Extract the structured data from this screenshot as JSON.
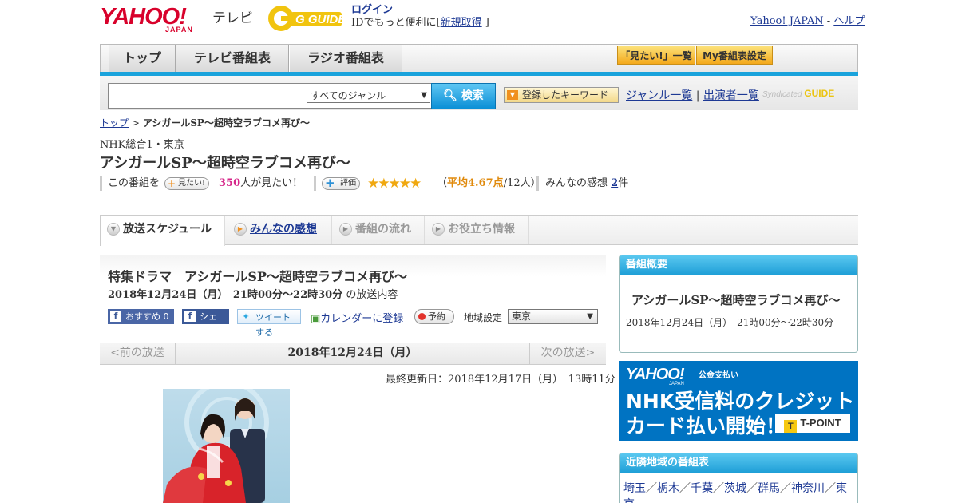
{
  "header": {
    "logo_text": "YAHOO!",
    "logo_sub": "JAPAN",
    "service": "テレビ",
    "gguide_logo": "G GUIDE",
    "login": "ログイン",
    "login_note_prefix": "IDでもっと便利に[",
    "signup": "新規取得",
    "login_note_suffix": "]",
    "yahoo_japan": "Yahoo! JAPAN",
    "sep": "-",
    "help": "ヘルプ"
  },
  "nav": {
    "tabs": [
      "トップ",
      "テレビ番組表",
      "ラジオ番組表"
    ],
    "mitai_list": "「見たい!」一覧",
    "my_schedule": "My番組表設定"
  },
  "search": {
    "genre_selected": "すべてのジャンル",
    "button": "検索",
    "keyword_btn": "登録したキーワード",
    "genre_list": "ジャンル一覧",
    "divider": "|",
    "performer_list": "出演者一覧",
    "syndicated": "Syndicated",
    "syndicated_logo": "GUIDE"
  },
  "breadcrumb": {
    "top": "トップ",
    "sep": ">",
    "current": "アシガールSP～超時空ラブコメ再び～"
  },
  "program": {
    "channel": "NHK総合1・東京",
    "title": "アシガールSP～超時空ラブコメ再び～",
    "this_program": "この番組を",
    "mitai_btn": "見たい!",
    "mitai_count": "350",
    "mitai_suffix": "人が見たい！",
    "rate_btn": "評価",
    "stars": "★★★★★",
    "rating_open": "（",
    "rating_avg": "平均4.67点",
    "rating_people": "/12人）",
    "impressions_label": "みんなの感想",
    "impressions_count": "2",
    "impressions_suffix": "件"
  },
  "detail_tabs": [
    "放送スケジュール",
    "みんなの感想",
    "番組の流れ",
    "お役立ち情報"
  ],
  "broadcast": {
    "heading": "特集ドラマ　アシガールSP～超時空ラブコメ再び～",
    "date_time": "2018年12月24日（月）　21時00分～22時30分",
    "date_suffix": "の放送内容",
    "fb_recommend": "おすすめ 0",
    "fb_share": "シェア",
    "tweet": "ツイートする",
    "calendar": "カレンダーに登録",
    "reserve": "予約",
    "region_label": "地域設定",
    "region_value": "東京",
    "prev": "<前の放送",
    "current_date": "2018年12月24日（月）",
    "next": "次の放送>",
    "updated": "最終更新日：2018年12月17日（月）　13時11分"
  },
  "overview": {
    "header": "番組概要",
    "title": "アシガールSP～超時空ラブコメ再び～",
    "date": "2018年12月24日（月）　21時00分～22時30分"
  },
  "banner": {
    "brand": "YAHOO!",
    "brand_sub": "JAPAN",
    "service": "公金支払い",
    "line1": "NHK受信料のクレジット",
    "line2": "カード払い開始！",
    "tpoint": "T-POINT"
  },
  "nearby": {
    "header": "近隣地域の番組表",
    "regions": [
      "埼玉",
      "栃木",
      "千葉",
      "茨城",
      "群馬",
      "神奈川",
      "東京"
    ],
    "sep": "／"
  },
  "colors": {
    "accent": "#1aa3dc",
    "link": "#1d3994",
    "star": "#f0a810",
    "count": "#d6278a"
  },
  "rating": {
    "average": 4.67,
    "max": 5
  }
}
